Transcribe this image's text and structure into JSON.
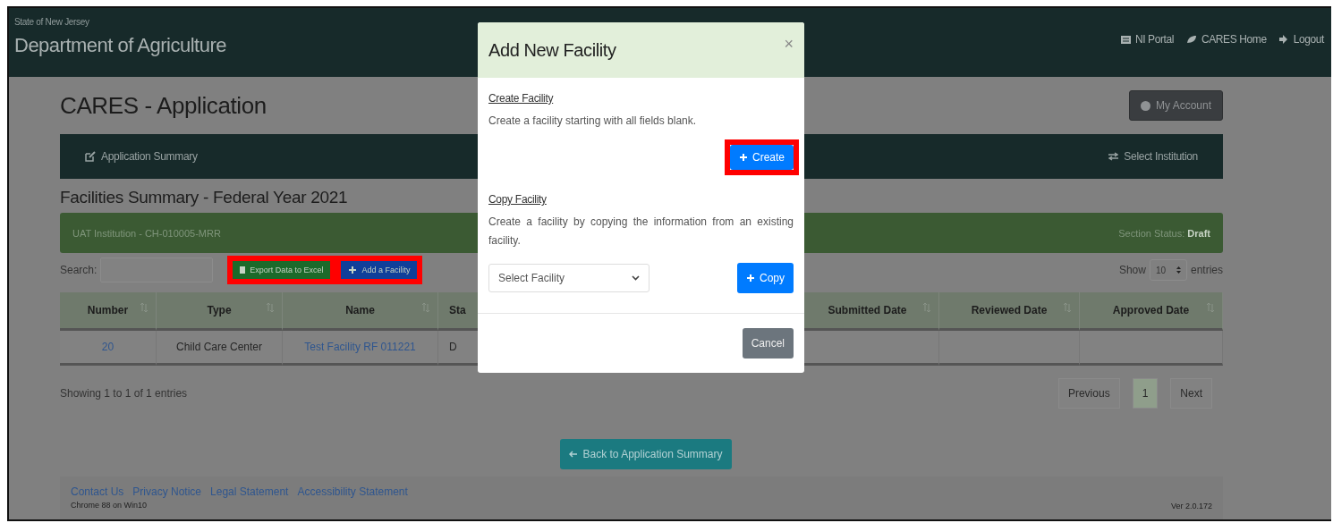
{
  "header": {
    "state": "State of New Jersey",
    "department": "Department of Agriculture",
    "links": [
      "NI Portal",
      "CARES Home",
      "Logout"
    ]
  },
  "page_title": "CARES - Application",
  "account_button": "My Account",
  "nav": {
    "left": "Application Summary",
    "right": "Select Institution"
  },
  "section_title": "Facilities Summary - Federal Year 2021",
  "banner": {
    "institution": "UAT Institution - CH-010005-MRR",
    "status": "Section Status: **Draft**"
  },
  "search": {
    "label": "Search:"
  },
  "toolbar": [
    {
      "label": "Export Data to Excel",
      "kind": "export",
      "highlighted": true
    },
    {
      "label": "Add a Facility",
      "kind": "add",
      "highlighted": true
    }
  ],
  "length": {
    "before": "Show",
    "value": "10",
    "after": "entries"
  },
  "table": {
    "columns": [
      "Number",
      "Type",
      "Name",
      "Sta",
      "Submitted Date",
      "Reviewed Date",
      "Approved Date"
    ],
    "rows": [
      [
        {
          "text": "20",
          "kind": "link"
        },
        {
          "text": "Child Care Center",
          "kind": "text"
        },
        {
          "text": "Test Facility RF 011221",
          "kind": "link"
        },
        {
          "text": "D",
          "kind": "text"
        },
        {
          "kind": "empty"
        },
        {
          "kind": "empty"
        },
        {
          "kind": "empty"
        }
      ]
    ]
  },
  "info": "Showing 1 to 1 of 1 entries",
  "pagination": [
    {
      "label": "Previous",
      "selected": false
    },
    {
      "label": "1",
      "selected": true
    },
    {
      "label": "Next",
      "selected": false
    }
  ],
  "back_button": "Back to Application Summary",
  "footer": {
    "links": [
      "Contact Us",
      "Privacy Notice",
      "Legal Statement",
      "Accessibility Statement"
    ],
    "browser": "Chrome 88 on Win10",
    "version": "Ver 2.0.172"
  },
  "modal": {
    "title": "Add New Facility",
    "close": "×",
    "create": {
      "heading": "Create Facility",
      "text": "Create a facility starting with all fields blank.",
      "button": "Create",
      "highlighted": true
    },
    "copy": {
      "heading": "Copy Facility",
      "text": "Create a facility by copying the information from an existing facility.",
      "select": "Select Facility",
      "button": "Copy",
      "highlighted": false
    },
    "cancel": "Cancel"
  }
}
